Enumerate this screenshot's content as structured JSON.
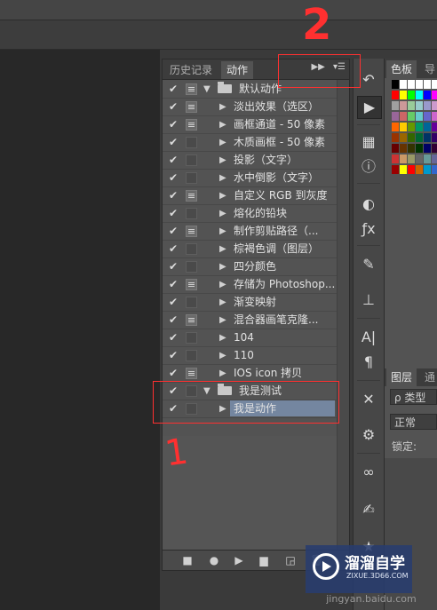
{
  "annotations": {
    "mark1": "1",
    "mark2": "2"
  },
  "actions_panel": {
    "tabs": [
      "历史记录",
      "动作"
    ],
    "rows": [
      {
        "label": "默认动作",
        "kind": "set",
        "checked": true,
        "dialog": true
      },
      {
        "label": "淡出效果（选区）",
        "kind": "action",
        "checked": true,
        "dialog": true
      },
      {
        "label": "画框通道 - 50 像素",
        "kind": "action",
        "checked": true,
        "dialog": true
      },
      {
        "label": "木质画框 - 50 像素",
        "kind": "action",
        "checked": true,
        "dialog": false
      },
      {
        "label": "投影（文字）",
        "kind": "action",
        "checked": true,
        "dialog": false
      },
      {
        "label": "水中倒影（文字）",
        "kind": "action",
        "checked": true,
        "dialog": false
      },
      {
        "label": "自定义 RGB 到灰度",
        "kind": "action",
        "checked": true,
        "dialog": true
      },
      {
        "label": "熔化的铅块",
        "kind": "action",
        "checked": true,
        "dialog": false
      },
      {
        "label": "制作剪贴路径（...",
        "kind": "action",
        "checked": true,
        "dialog": true
      },
      {
        "label": "棕褐色调（图层）",
        "kind": "action",
        "checked": true,
        "dialog": false
      },
      {
        "label": "四分颜色",
        "kind": "action",
        "checked": true,
        "dialog": false
      },
      {
        "label": "存储为 Photoshop...",
        "kind": "action",
        "checked": true,
        "dialog": true
      },
      {
        "label": "渐变映射",
        "kind": "action",
        "checked": true,
        "dialog": false
      },
      {
        "label": "混合器画笔克隆...",
        "kind": "action",
        "checked": true,
        "dialog": true
      },
      {
        "label": "104",
        "kind": "action",
        "checked": true,
        "dialog": false
      },
      {
        "label": "110",
        "kind": "action",
        "checked": true,
        "dialog": false
      },
      {
        "label": "IOS icon 拷贝",
        "kind": "action",
        "checked": true,
        "dialog": true
      },
      {
        "label": "我是测试",
        "kind": "set",
        "checked": true,
        "dialog": false
      },
      {
        "label": "我是动作",
        "kind": "action",
        "checked": true,
        "dialog": false,
        "selected": true
      }
    ],
    "bottom_buttons": [
      "stop-icon",
      "record-icon",
      "play-icon",
      "new-set-icon",
      "new-action-icon"
    ]
  },
  "tools": [
    "history-brush-icon",
    "play-action-icon",
    "3d-cube-icon",
    "info-icon",
    "color-circle-icon",
    "fx-icon",
    "brush-icon",
    "stamp-icon",
    "character-icon",
    "paragraph-icon",
    "tools-icon",
    "3d-gyro-icon",
    "creative-cloud-icon",
    "adjust-icon",
    "shape-icon"
  ],
  "right_panels": {
    "tabs": [
      "色板",
      "导"
    ],
    "layer_tabs": [
      "图层",
      "通"
    ],
    "kind_filter": "ρ 类型",
    "blend_mode": "正常",
    "lock_label": "锁定:",
    "swatch_colors": [
      [
        "#000000",
        "#ffffff",
        "#ffffff",
        "#ffffff",
        "#ffffff",
        "#ffffff"
      ],
      [
        "#ff0000",
        "#ffff00",
        "#00ff00",
        "#00ffff",
        "#0000ff",
        "#ff00ff"
      ],
      [
        "#a0a0a0",
        "#cc9999",
        "#99cc99",
        "#99cccc",
        "#9999cc",
        "#cc99cc"
      ],
      [
        "#996699",
        "#cc6666",
        "#66cc66",
        "#66cccc",
        "#6666cc",
        "#cc66cc"
      ],
      [
        "#ff6600",
        "#ffcc00",
        "#669900",
        "#009966",
        "#006699",
        "#660099"
      ],
      [
        "#993300",
        "#996600",
        "#336600",
        "#006633",
        "#003366",
        "#330066"
      ],
      [
        "#660000",
        "#663300",
        "#333300",
        "#003300",
        "#000066",
        "#330033"
      ],
      [
        "#cc3333",
        "#cc9966",
        "#999966",
        "#666666",
        "#669999",
        "#666699"
      ],
      [
        "#990000",
        "#ffff00",
        "#ff0000",
        "#cc6600",
        "#0099cc",
        "#3366cc"
      ]
    ]
  },
  "watermark": {
    "title": "溜溜自学",
    "url": "ZIXUE.3D66.COM",
    "footer": "jingyan.baidu.com"
  }
}
